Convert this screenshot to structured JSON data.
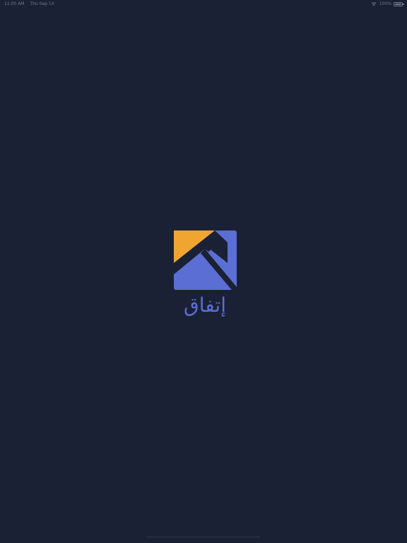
{
  "status_bar": {
    "time": "11:00 AM",
    "date": "Thu Sep 14",
    "battery_percent": "100%",
    "battery_level": 1.0,
    "wifi_icon": "wifi-icon",
    "battery_icon": "battery-icon"
  },
  "splash": {
    "logo_icon": "house-roof-logo-icon",
    "app_name": "إتفاق",
    "colors": {
      "background": "#1b2134",
      "logo_blue": "#5b6ed3",
      "logo_orange": "#f0a531",
      "logo_dark": "#1b2134"
    }
  }
}
